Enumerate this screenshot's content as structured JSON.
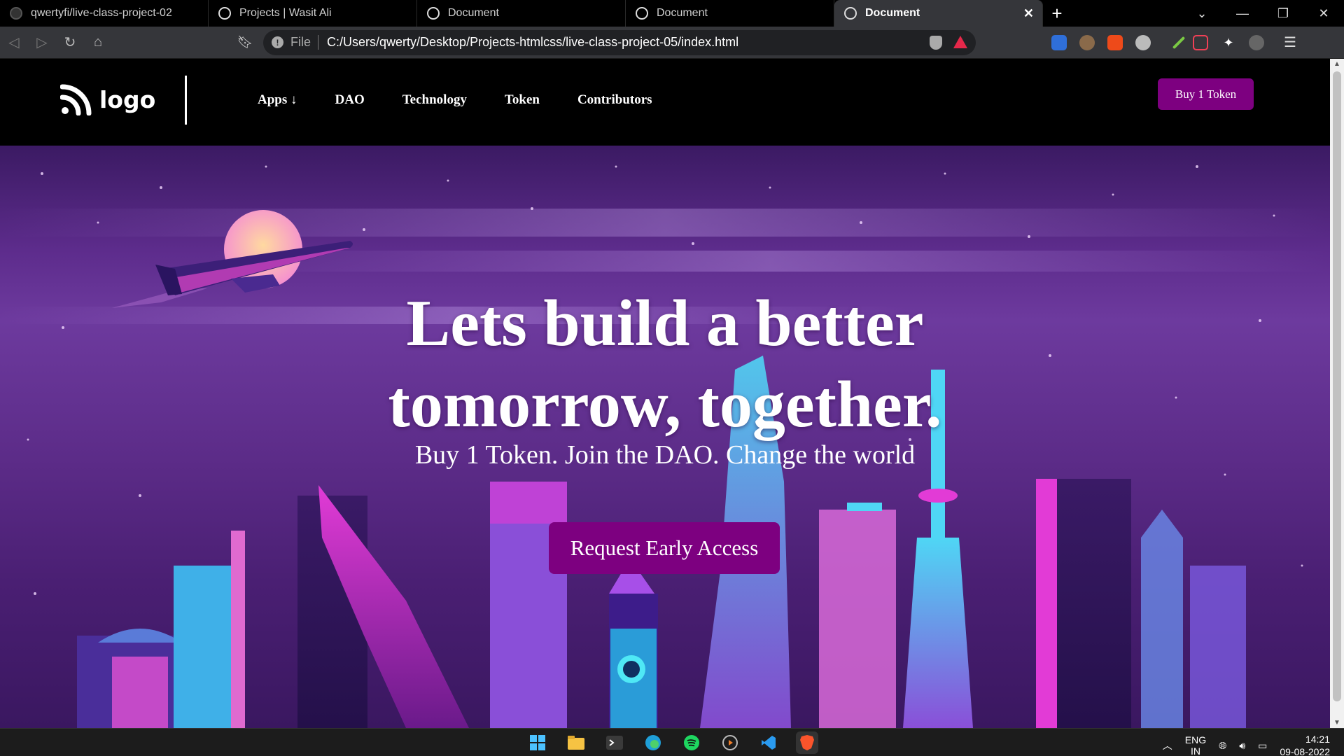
{
  "browser": {
    "tabs": [
      {
        "title": "qwertyfi/live-class-project-02",
        "icon": "github-icon",
        "active": false
      },
      {
        "title": "Projects | Wasit Ali",
        "icon": "globe-icon",
        "active": false
      },
      {
        "title": "Document",
        "icon": "globe-icon",
        "active": false
      },
      {
        "title": "Document",
        "icon": "globe-icon",
        "active": false
      },
      {
        "title": "Document",
        "icon": "globe-icon",
        "active": true
      }
    ],
    "new_tab": "+",
    "close_tab": "✕",
    "address": {
      "scheme": "File",
      "url": "C:/Users/qwerty/Desktop/Projects-htmlcss/live-class-project-05/index.html"
    }
  },
  "site": {
    "logo_text": "logo",
    "nav": [
      "Apps ↓",
      "DAO",
      "Technology",
      "Token",
      "Contributors"
    ],
    "buy_button": "Buy 1 Token",
    "hero": {
      "title_line1": "Lets build a better",
      "title_line2": "tomorrow, together.",
      "subtitle": "Buy 1 Token. Join the DAO. Change the world",
      "cta": "Request Early Access"
    }
  },
  "taskbar": {
    "lang_line1": "ENG",
    "lang_line2": "IN",
    "time": "14:21",
    "date": "09-08-2022"
  },
  "colors": {
    "accent": "#7d0080",
    "hero_purple": "#5d2c8c",
    "nav_bg": "#000000"
  }
}
